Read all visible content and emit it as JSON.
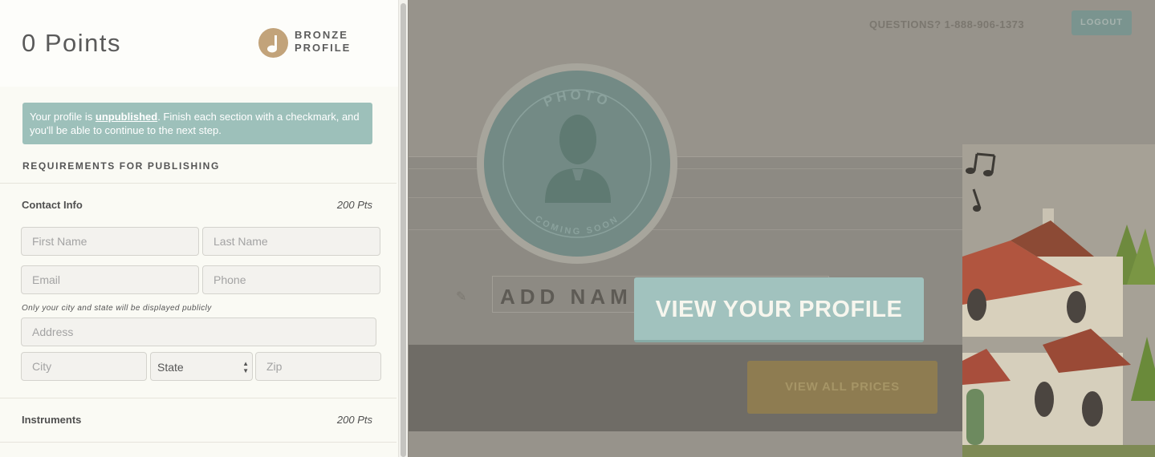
{
  "panel": {
    "points": "0 Points",
    "badge": {
      "line1": "BRONZE",
      "line2": "PROFILE"
    },
    "notice": {
      "prefix": "Your profile is ",
      "link": "unpublished",
      "suffix": ". Finish each section with a checkmark, and you'll be able to continue to the next step."
    },
    "requirements_heading": "REQUIREMENTS FOR PUBLISHING",
    "contact": {
      "title": "Contact Info",
      "points": "200 Pts",
      "first_name_placeholder": "First Name",
      "last_name_placeholder": "Last Name",
      "email_placeholder": "Email",
      "phone_placeholder": "Phone",
      "city_note": "Only your city and state will be displayed publicly",
      "address_placeholder": "Address",
      "city_placeholder": "City",
      "state_value": "State",
      "zip_placeholder": "Zip"
    },
    "instruments": {
      "title": "Instruments",
      "points": "200 Pts"
    }
  },
  "header": {
    "questions": "QUESTIONS? 1-888-906-1373",
    "logout": "LOGOUT"
  },
  "profile": {
    "photo_top": "PHOTO",
    "photo_bottom": "COMING SOON",
    "add_name": "ADD NAM",
    "view_all_prices": "VIEW ALL PRICES",
    "view_profile": "VIEW YOUR PROFILE"
  },
  "colors": {
    "accent_teal": "#9dc0ba",
    "badge_bronze": "#c2a37a",
    "overlay_bg": "#97938b"
  }
}
